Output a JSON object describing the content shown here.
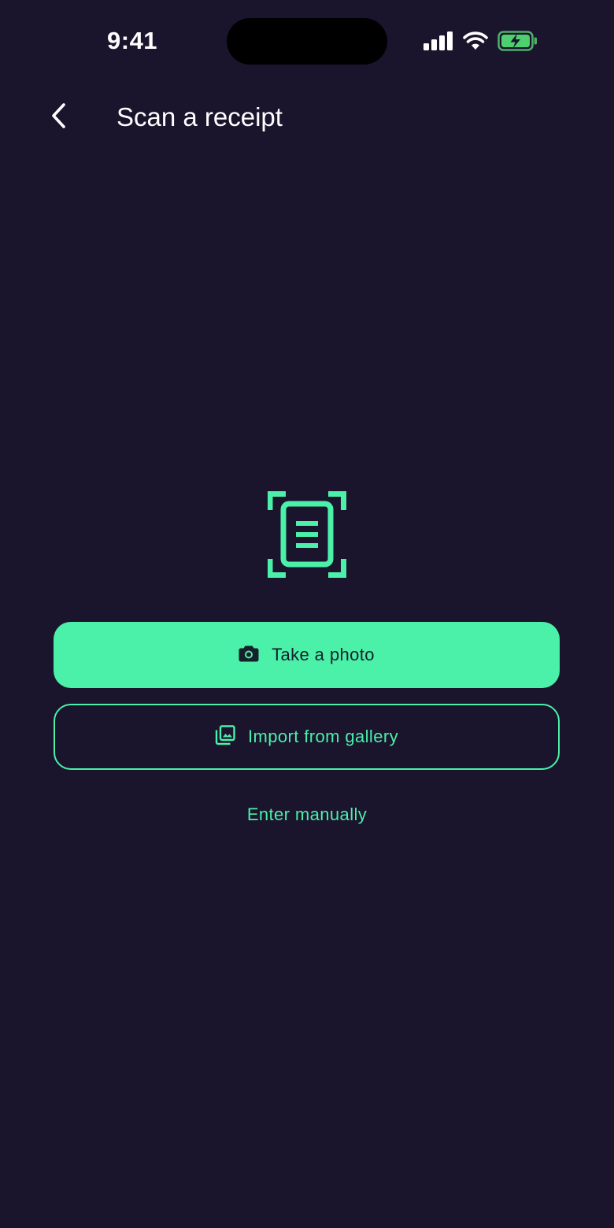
{
  "status_bar": {
    "time": "9:41",
    "icons": [
      "cellular-signal-icon",
      "wifi-icon",
      "battery-charging-icon"
    ]
  },
  "header": {
    "back_icon": "chevron-left-icon",
    "title": "Scan a receipt"
  },
  "hero": {
    "icon": "receipt-scan-icon"
  },
  "actions": {
    "take_photo": {
      "label": "Take a photo",
      "icon": "camera-icon"
    },
    "import_gallery": {
      "label": "Import from gallery",
      "icon": "gallery-icon"
    },
    "enter_manually": {
      "label": "Enter manually"
    }
  },
  "colors": {
    "background": "#1a142d",
    "accent": "#4bf0a9",
    "primary_text_on_accent": "#17202a",
    "text": "#ffffff"
  }
}
